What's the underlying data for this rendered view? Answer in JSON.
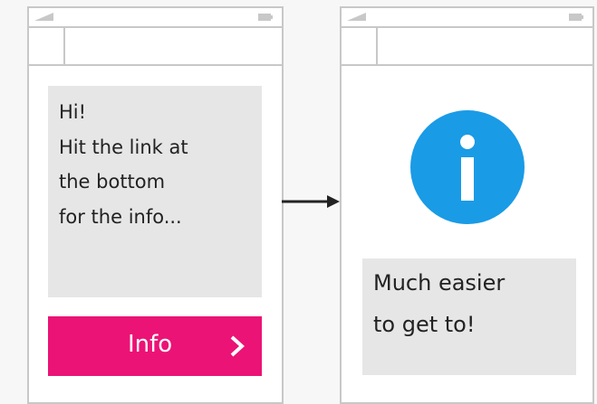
{
  "left_screen": {
    "message_lines": [
      "Hi!",
      "Hit the link at",
      "the bottom",
      "for the info..."
    ],
    "button_label": "Info",
    "button_color": "#eb1375",
    "button_icon": "chevron-right-icon"
  },
  "right_screen": {
    "icon": "info-icon",
    "icon_color": "#1a9be6",
    "message_lines": [
      "Much easier",
      "to get to!"
    ]
  },
  "flow_arrow": "arrow-right-icon"
}
